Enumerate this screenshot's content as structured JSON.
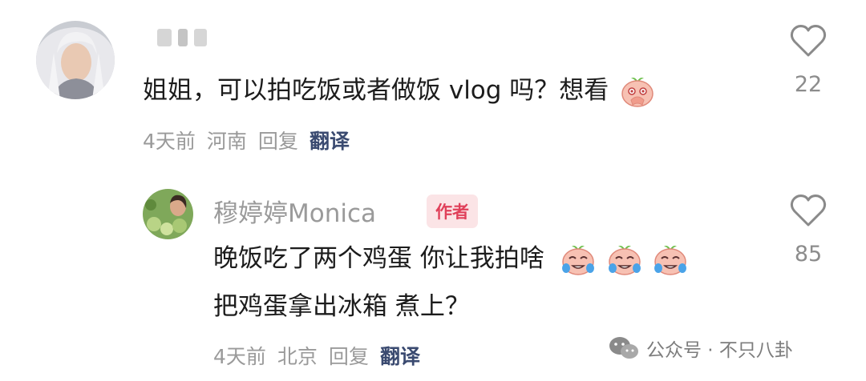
{
  "comment": {
    "username_hidden": true,
    "text": "姐姐，可以拍吃饭或者做饭 vlog 吗？想看",
    "emoji": "peach-praying-emoji",
    "meta": {
      "time": "4天前",
      "location": "河南",
      "reply": "回复",
      "translate": "翻译"
    },
    "like_count": "22"
  },
  "reply": {
    "username": "穆婷婷Monica",
    "badge": "作者",
    "line1": "晚饭吃了两个鸡蛋 你让我拍啥",
    "line1_emojis": [
      "peach-crying-emoji",
      "peach-crying-emoji",
      "peach-crying-emoji"
    ],
    "line2": "把鸡蛋拿出冰箱 煮上？",
    "meta": {
      "time": "4天前",
      "location": "北京",
      "reply": "回复",
      "translate": "翻译"
    },
    "like_count": "85"
  },
  "watermark": {
    "icon": "wechat-icon",
    "text": "公众号 · 不只八卦"
  },
  "colors": {
    "translate": "#3a4a70",
    "badge_bg": "#fbe4e6",
    "badge_text": "#e0405a",
    "muted": "#9a9a9a"
  }
}
